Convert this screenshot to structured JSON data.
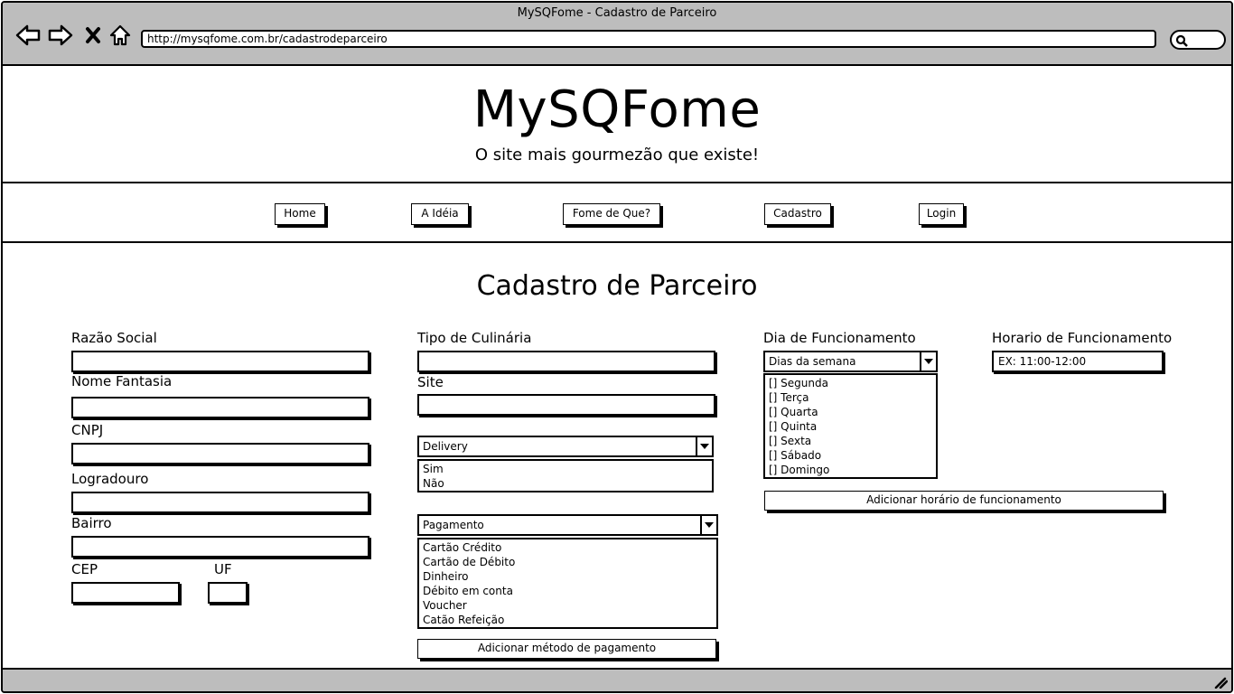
{
  "window": {
    "title": "MySQFome - Cadastro de Parceiro",
    "url": "http://mysqfome.com.br/cadastrodeparceiro"
  },
  "header": {
    "logo": "MySQFome",
    "tagline": "O site mais gourmezão que existe!"
  },
  "nav": {
    "items": [
      "Home",
      "A Idéia",
      "Fome de Que?",
      "Cadastro",
      "Login"
    ]
  },
  "form": {
    "title": "Cadastro de Parceiro",
    "razao_social": "Razão Social",
    "nome_fantasia": "Nome Fantasia",
    "cnpj": "CNPJ",
    "logradouro": "Logradouro",
    "bairro": "Bairro",
    "cep": "CEP",
    "uf": "UF",
    "tipo_culinaria": "Tipo de Culinária",
    "site": "Site",
    "delivery": {
      "selected": "Delivery",
      "options": [
        "Sim",
        "Não"
      ]
    },
    "pagamento": {
      "selected": "Pagamento",
      "options": [
        "Cartão Crédito",
        "Cartão de Débito",
        "Dinheiro",
        "Débito em conta",
        "Voucher",
        "Catão Refeição"
      ]
    },
    "add_payment_button": "Adicionar método de pagamento",
    "dia_funcionamento": "Dia de Funcionamento",
    "dias": {
      "selected": "Dias da semana",
      "options": [
        "[] Segunda",
        "[] Terça",
        "[] Quarta",
        "[] Quinta",
        "[] Sexta",
        "[] Sábado",
        "[] Domingo"
      ]
    },
    "horario_funcionamento": "Horario de Funcionamento",
    "horario_value": "EX: 11:00-12:00",
    "add_hours_button": "Adicionar horário de funcionamento"
  }
}
